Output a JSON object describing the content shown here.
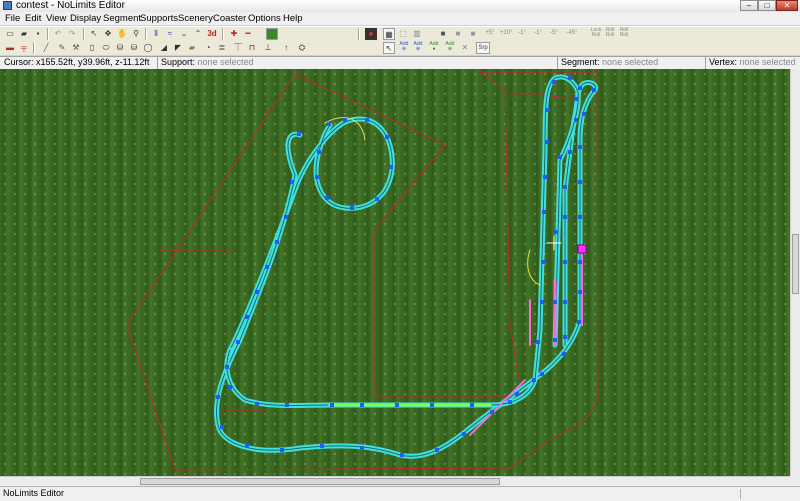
{
  "window": {
    "title": "contest - NoLimits Editor",
    "min": "–",
    "max": "□",
    "close": "✕"
  },
  "menu": [
    "File",
    "Edit",
    "View",
    "Display",
    "Segment",
    "Supports",
    "Scenery",
    "Coaster",
    "Options",
    "Help"
  ],
  "toolbar": {
    "add_labels": [
      "Add",
      "Add",
      "Add",
      "Add"
    ],
    "lock_labels": [
      "Lock",
      "Roll",
      "Roll"
    ],
    "lock_sub": [
      "Roll",
      "Roll",
      "Roll"
    ],
    "strip_label": "Srp",
    "rot_labels": [
      "+5°",
      "+10°",
      "-1°",
      "-1°",
      "-5°",
      "-45°"
    ],
    "three_d": "3d"
  },
  "info": {
    "cursor_label": "Cursor:",
    "cursor_value": "x155.52ft, y39.96ft, z-11.12ft",
    "support_label": "Support:",
    "support_value": "none selected",
    "segment_label": "Segment:",
    "segment_value": "none selected",
    "vertex_label": "Vertex:",
    "vertex_value": "none selected"
  },
  "status": {
    "text": "NoLimits Editor"
  },
  "colors": {
    "track": "#40e0e0",
    "vertex": "#1e5cff",
    "boundary": "#c0282a",
    "selected": "#ff30ff",
    "terrain": "#3a6a22"
  }
}
